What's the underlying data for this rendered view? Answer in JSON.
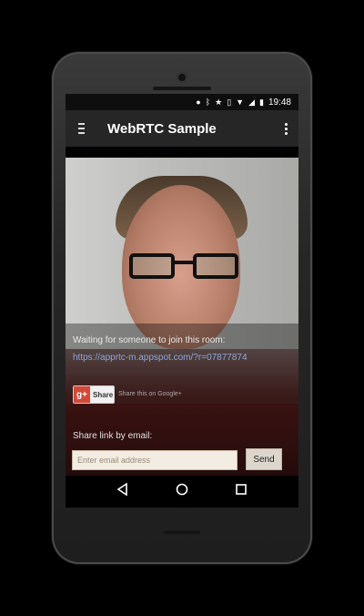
{
  "statusbar": {
    "time": "19:48",
    "icons": [
      "location-icon",
      "bluetooth-icon",
      "star-icon",
      "vibrate-icon",
      "wifi-icon",
      "signal-icon",
      "battery-icon"
    ]
  },
  "toolbar": {
    "title": "WebRTC Sample"
  },
  "room": {
    "waiting_text": "Waiting for someone to join this room:",
    "link": "https://apprtc-m.appspot.com/?r=07877874"
  },
  "share": {
    "gplus_logo": "g+",
    "gplus_label": "Share",
    "gplus_note": "Share this on Google+"
  },
  "email": {
    "label": "Share link by email:",
    "placeholder": "Enter email address",
    "send_label": "Send"
  },
  "colors": {
    "toolbar": "#262626",
    "link": "#8fa6d9",
    "gplus_red": "#d34836"
  }
}
